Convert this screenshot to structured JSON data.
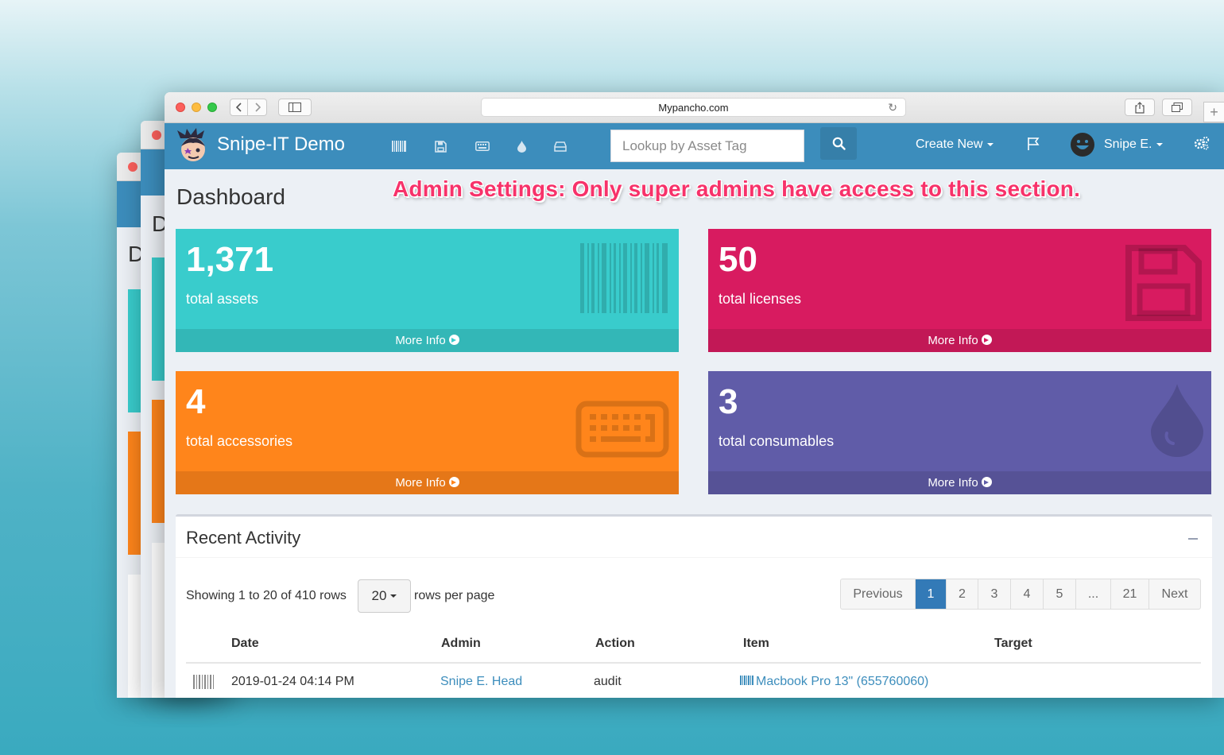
{
  "browser": {
    "url": "Mypancho.com"
  },
  "navbar": {
    "brand": "Snipe-IT Demo",
    "search_placeholder": "Lookup by Asset Tag",
    "create_new": "Create New",
    "user": "Snipe E."
  },
  "page": {
    "title": "Dashboard",
    "admin_note": "Admin Settings: Only super admins have access to this section."
  },
  "stats": {
    "assets": {
      "count": "1,371",
      "label": "total assets",
      "more": "More Info",
      "color": "#39cccc"
    },
    "licenses": {
      "count": "50",
      "label": "total licenses",
      "more": "More Info",
      "color": "#d81b60"
    },
    "accessories": {
      "count": "4",
      "label": "total accessories",
      "more": "More Info",
      "color": "#ff851b"
    },
    "consumables": {
      "count": "3",
      "label": "total consumables",
      "more": "More Info",
      "color": "#605ca8"
    }
  },
  "recent_activity": {
    "title": "Recent Activity",
    "showing": "Showing 1 to 20 of 410 rows",
    "page_size": "20",
    "rows_per_page": "rows per page",
    "pagination": [
      "Previous",
      "1",
      "2",
      "3",
      "4",
      "5",
      "...",
      "21",
      "Next"
    ],
    "active_page": "1",
    "columns": [
      "Date",
      "Admin",
      "Action",
      "Item",
      "Target"
    ],
    "rows": [
      {
        "date": "2019-01-24 04:14 PM",
        "admin": "Snipe E. Head",
        "action": "audit",
        "item": "Macbook Pro 13\" (655760060)",
        "target": ""
      }
    ]
  },
  "colors": {
    "navbar": "#3c8dbc",
    "accent_link": "#3c8dbc",
    "annotation": "#f7326a"
  }
}
